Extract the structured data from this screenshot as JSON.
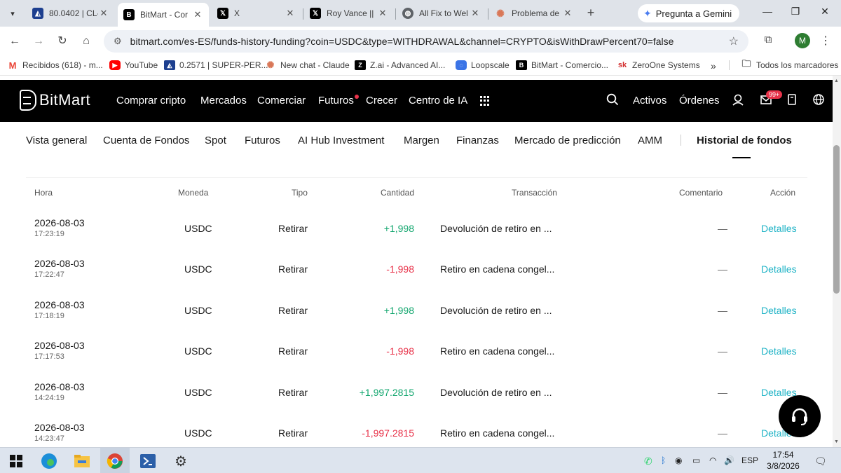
{
  "browser": {
    "tabs": [
      {
        "title": "80.0402 | CL-",
        "icon": "bitmart-chart-icon",
        "color": "#1d3f8f"
      },
      {
        "title": "BitMart - Cor",
        "icon": "bitmart-icon",
        "color": "#000000",
        "active": true
      },
      {
        "title": "X",
        "icon": "x-icon",
        "color": "#000000"
      },
      {
        "title": "Roy Vance ||",
        "icon": "x-icon",
        "color": "#000000"
      },
      {
        "title": "All Fix to Wel",
        "icon": "globe-icon",
        "color": "#5f6368"
      },
      {
        "title": "Problema de",
        "icon": "claude-icon",
        "color": "#d97757"
      }
    ],
    "gemini_label": "Pregunta a Gemini",
    "url": "bitmart.com/es-ES/funds-history-funding?coin=USDC&type=WITHDRAWAL&channel=CRYPTO&isWithDrawPercent70=false",
    "profile_initial": "M",
    "bookmarks": [
      {
        "label": "Recibidos (618) - m...",
        "icon": "gmail-icon"
      },
      {
        "label": "YouTube",
        "icon": "youtube-icon"
      },
      {
        "label": "0.2571 | SUPER-PER...",
        "icon": "bitmart-chart-icon"
      },
      {
        "label": "New chat - Claude",
        "icon": "claude-icon"
      },
      {
        "label": "Z.ai - Advanced AI...",
        "icon": "zai-icon"
      },
      {
        "label": "Loopscale",
        "icon": "loopscale-icon"
      },
      {
        "label": "BitMart - Comercio...",
        "icon": "bitmart-icon"
      },
      {
        "label": "ZeroOne Systems",
        "icon": "zeroone-icon"
      }
    ],
    "bookmarks_overflow": "»",
    "all_bookmarks": "Todos los marcadores"
  },
  "site": {
    "logo_text": "BitMart",
    "nav": [
      "Comprar cripto",
      "Mercados",
      "Comerciar",
      "Futuros",
      "Crecer",
      "Centro de IA"
    ],
    "right_nav": [
      "Activos",
      "Órdenes"
    ],
    "notification_badge": "99+",
    "subnav": [
      "Vista general",
      "Cuenta de Fondos",
      "Spot",
      "Futuros",
      "AI Hub Investment",
      "Margen",
      "Finanzas",
      "Mercado de predicción",
      "AMM",
      "Historial de fondos"
    ],
    "active_subnav": "Historial de fondos",
    "accent_color": "#1fb3c6",
    "positive_color": "#12a66e",
    "negative_color": "#e8334a"
  },
  "table": {
    "headers": {
      "time": "Hora",
      "coin": "Moneda",
      "type": "Tipo",
      "amount": "Cantidad",
      "transaction": "Transacción",
      "comment": "Comentario",
      "action": "Acción"
    },
    "rows": [
      {
        "date": "2026-08-03",
        "time": "17:23:19",
        "coin": "USDC",
        "type": "Retirar",
        "amount": "+1,998",
        "sign": "pos",
        "transaction": "Devolución de retiro en ...",
        "comment": "—",
        "action": "Detalles"
      },
      {
        "date": "2026-08-03",
        "time": "17:22:47",
        "coin": "USDC",
        "type": "Retirar",
        "amount": "-1,998",
        "sign": "neg",
        "transaction": "Retiro en cadena congel...",
        "comment": "—",
        "action": "Detalles"
      },
      {
        "date": "2026-08-03",
        "time": "17:18:19",
        "coin": "USDC",
        "type": "Retirar",
        "amount": "+1,998",
        "sign": "pos",
        "transaction": "Devolución de retiro en ...",
        "comment": "—",
        "action": "Detalles"
      },
      {
        "date": "2026-08-03",
        "time": "17:17:53",
        "coin": "USDC",
        "type": "Retirar",
        "amount": "-1,998",
        "sign": "neg",
        "transaction": "Retiro en cadena congel...",
        "comment": "—",
        "action": "Detalles"
      },
      {
        "date": "2026-08-03",
        "time": "14:24:19",
        "coin": "USDC",
        "type": "Retirar",
        "amount": "+1,997.2815",
        "sign": "pos",
        "transaction": "Devolución de retiro en ...",
        "comment": "—",
        "action": "Detalles"
      },
      {
        "date": "2026-08-03",
        "time": "14:23:47",
        "coin": "USDC",
        "type": "Retirar",
        "amount": "-1,997.2815",
        "sign": "neg",
        "transaction": "Retiro en cadena congel...",
        "comment": "—",
        "action": "Detalles"
      }
    ]
  },
  "taskbar": {
    "language": "ESP",
    "clock_time": "17:54",
    "clock_date": "3/8/2026"
  }
}
